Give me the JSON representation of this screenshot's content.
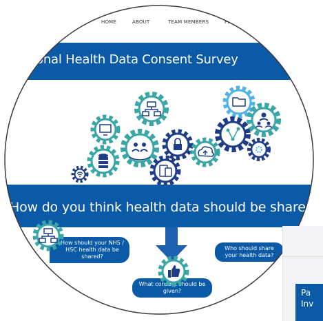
{
  "nav": {
    "items": [
      "HOME",
      "ABOUT",
      "TEAM MEMBERS",
      "PPI"
    ]
  },
  "banner": {
    "title": "onal Health Data Consent Survey"
  },
  "question": {
    "text": "How do you think health data should be shared and use"
  },
  "bubbles": {
    "how_shared": "How should your NHS / HSC health data be shared?",
    "who_share": "Who should share your health data?",
    "consent": "What consent should be given?"
  },
  "side_panel": {
    "line1": "Pa",
    "line2": "Inv"
  },
  "colors": {
    "brand_blue": "#0b5aa7",
    "gear_teal": "#3aa6a6",
    "gear_navy": "#1f3c88",
    "gear_sky": "#4fb3e8"
  },
  "icons": [
    "computer-network-icon",
    "monitor-icon",
    "people-icon",
    "lock-icon",
    "cloud-icon",
    "database-icon",
    "devices-icon",
    "folder-icon",
    "share-icon",
    "user-group-icon",
    "gear-settings-icon",
    "thumbs-up-icon",
    "wifi-icon"
  ]
}
